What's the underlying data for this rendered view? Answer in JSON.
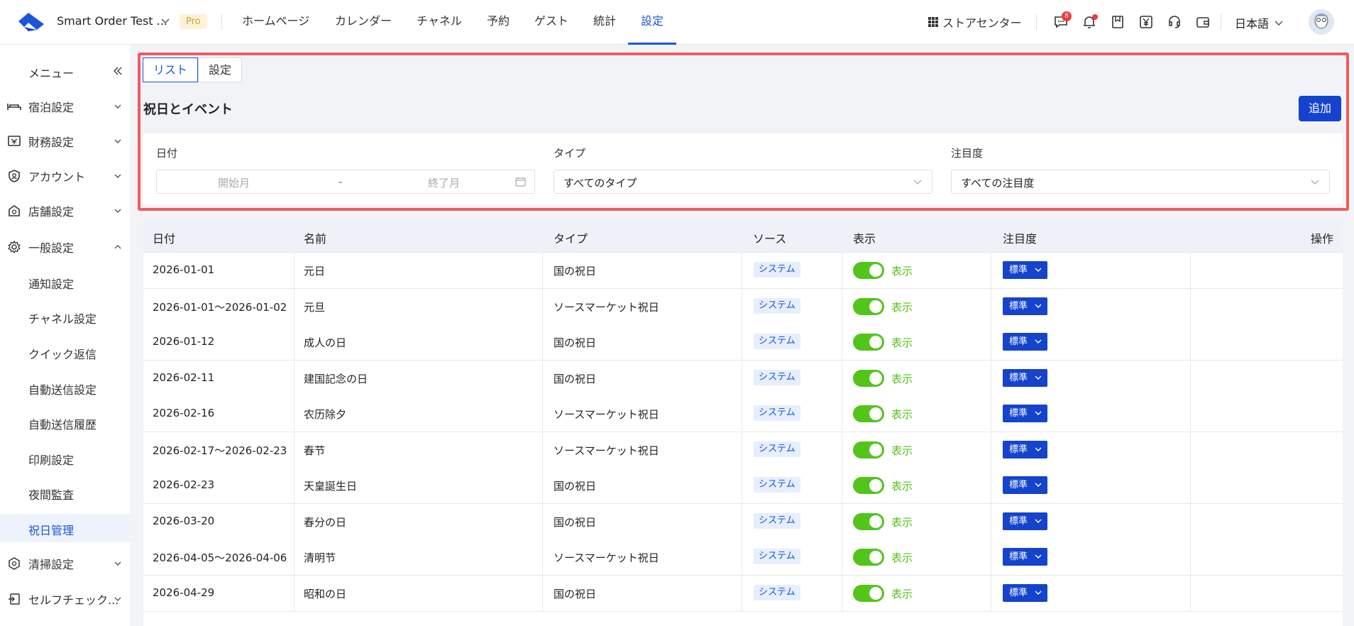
{
  "header": {
    "store_name": "Smart Order Test ...",
    "plan_badge": "Pro",
    "nav": [
      "ホームページ",
      "カレンダー",
      "チャネル",
      "予約",
      "ゲスト",
      "統計",
      "設定"
    ],
    "active_nav": "設定",
    "store_center": "ストアセンター",
    "message_count": "8",
    "language": "日本語"
  },
  "sidebar": {
    "title": "メニュー",
    "groups": [
      {
        "label": "宿泊設定",
        "icon": "bed-icon"
      },
      {
        "label": "財務設定",
        "icon": "finance-icon"
      },
      {
        "label": "アカウント",
        "icon": "account-shield-icon"
      },
      {
        "label": "店舗設定",
        "icon": "store-icon"
      },
      {
        "label": "一般設定",
        "icon": "gear-icon"
      }
    ],
    "sub_items": [
      "通知設定",
      "チャネル設定",
      "クイック返信",
      "自動送信設定",
      "自動送信履歴",
      "印刷設定",
      "夜間監査",
      "祝日管理"
    ],
    "active_sub": "祝日管理",
    "after_groups": [
      {
        "label": "清掃設定",
        "icon": "cleaning-icon"
      },
      {
        "label": "セルフチェック...",
        "icon": "self-checkin-icon"
      }
    ]
  },
  "main": {
    "tabs": [
      "リスト",
      "設定"
    ],
    "active_tab": "リスト",
    "section_title": "祝日とイベント",
    "add_button": "追加",
    "filters": {
      "date_label": "日付",
      "start_placeholder": "開始月",
      "range_sep": "-",
      "end_placeholder": "終了月",
      "type_label": "タイプ",
      "type_value": "すべてのタイプ",
      "attention_label": "注目度",
      "attention_value": "すべての注目度"
    },
    "table": {
      "columns": [
        "日付",
        "名前",
        "タイプ",
        "ソース",
        "表示",
        "注目度",
        "操作"
      ],
      "rows": [
        {
          "date": "2026-01-01",
          "name": "元日",
          "type": "国の祝日",
          "source": "システム",
          "display": "表示",
          "level": "標準"
        },
        {
          "date": "2026-01-01～2026-01-02",
          "name": "元旦",
          "type": "ソースマーケット祝日",
          "source": "システム",
          "display": "表示",
          "level": "標準"
        },
        {
          "date": "2026-01-12",
          "name": "成人の日",
          "type": "国の祝日",
          "source": "システム",
          "display": "表示",
          "level": "標準"
        },
        {
          "date": "2026-02-11",
          "name": "建国記念の日",
          "type": "国の祝日",
          "source": "システム",
          "display": "表示",
          "level": "標準"
        },
        {
          "date": "2026-02-16",
          "name": "农历除夕",
          "type": "ソースマーケット祝日",
          "source": "システム",
          "display": "表示",
          "level": "標準"
        },
        {
          "date": "2026-02-17～2026-02-23",
          "name": "春节",
          "type": "ソースマーケット祝日",
          "source": "システム",
          "display": "表示",
          "level": "標準"
        },
        {
          "date": "2026-02-23",
          "name": "天皇誕生日",
          "type": "国の祝日",
          "source": "システム",
          "display": "表示",
          "level": "標準"
        },
        {
          "date": "2026-03-20",
          "name": "春分の日",
          "type": "国の祝日",
          "source": "システム",
          "display": "表示",
          "level": "標準"
        },
        {
          "date": "2026-04-05～2026-04-06",
          "name": "清明节",
          "type": "ソースマーケット祝日",
          "source": "システム",
          "display": "表示",
          "level": "標準"
        },
        {
          "date": "2026-04-29",
          "name": "昭和の日",
          "type": "国の祝日",
          "source": "システム",
          "display": "表示",
          "level": "標準"
        }
      ]
    }
  },
  "colors": {
    "accent": "#1a56db",
    "primary_button": "#1443cc",
    "toggle_on": "#52c41a",
    "highlight_border": "#f05a60"
  }
}
